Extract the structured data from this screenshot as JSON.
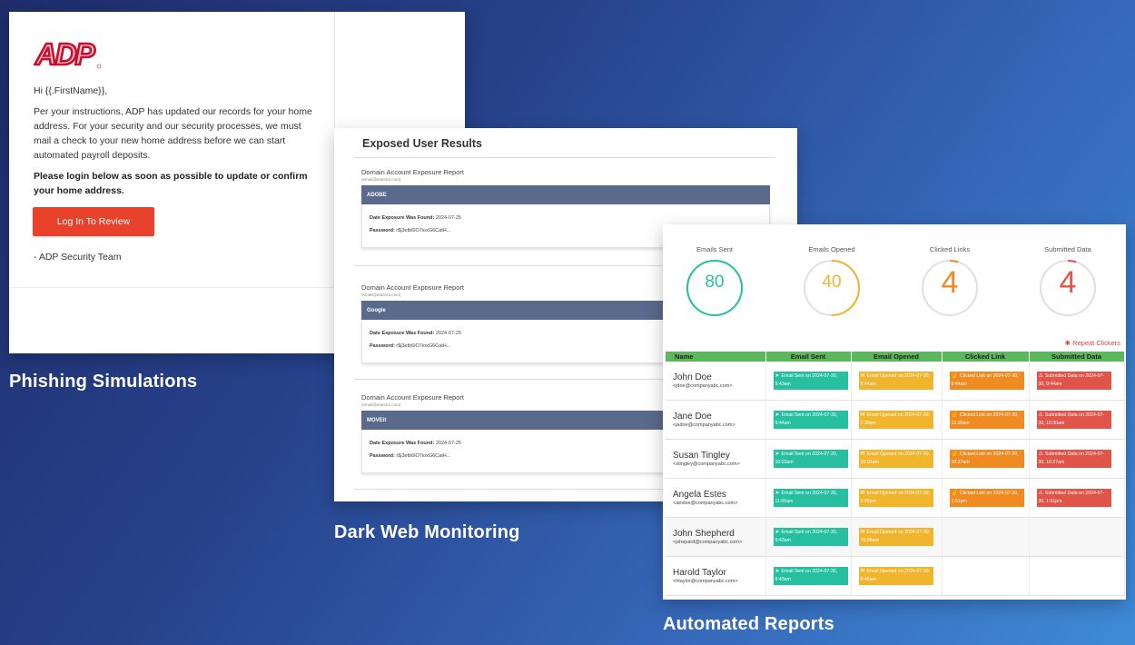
{
  "colors": {
    "brand_red": "#c8102e",
    "cta_red": "#e8412c",
    "sent_teal": "#26c0a0",
    "opened_yellow": "#f0b52c",
    "clicked_orange": "#f08b22",
    "submitted_red": "#e0544a",
    "table_header_green": "#5cb85c",
    "report_bar": "#5a6a8c"
  },
  "captions": {
    "phishing": "Phishing Simulations",
    "darkweb": "Dark Web Monitoring",
    "reports": "Automated Reports"
  },
  "email": {
    "logo_text": "ADP",
    "greeting": "Hi {{.FirstName}},",
    "body": "Per your instructions, ADP has updated our records for your home address. For your security and our security processes, we must mail a check to your new home address before we can start automated payroll deposits.",
    "emphasis": "Please login below as soon as possible to update or confirm your home address.",
    "cta_label": "Log In To Review",
    "signature": "- ADP Security Team"
  },
  "darkweb": {
    "title": "Exposed User Results",
    "entries": [
      {
        "report": "Domain Account Exposure Report",
        "sub": "(email@etactics.com)",
        "source": "ADOBE",
        "date_label": "Date Exposure Was Found:",
        "date": "2024-07-25",
        "password_label": "Password:",
        "password": "r$j3etb6lO7ioxG6CatH..."
      },
      {
        "report": "Domain Account Exposure Report",
        "sub": "(email@etactics.com)",
        "source": "Google",
        "date_label": "Date Exposure Was Found:",
        "date": "2024-07-25",
        "password_label": "Password:",
        "password": "r$j3etb6lO7ioxG6CatH..."
      },
      {
        "report": "Domain Account Exposure Report",
        "sub": "(email@etactics.com)",
        "source": "MOVEit",
        "date_label": "Date Exposure Was Found:",
        "date": "2024-07-25",
        "password_label": "Password:",
        "password": "r$j3etb6lO7ioxG6CatH..."
      }
    ]
  },
  "report": {
    "stats": [
      {
        "label": "Emails Sent",
        "value": "80",
        "fraction": 1.0,
        "color": "#26c0a0"
      },
      {
        "label": "Emails Opened",
        "value": "40",
        "fraction": 0.5,
        "color": "#f0b52c"
      },
      {
        "label": "Clicked Links",
        "value": "4",
        "fraction": 0.05,
        "color": "#f08b22"
      },
      {
        "label": "Submitted Data",
        "value": "4",
        "fraction": 0.05,
        "color": "#e0544a"
      }
    ],
    "repeat_clickers": "Repeat Clickers",
    "columns": [
      "Name",
      "Email Sent",
      "Email Opened",
      "Clicked Link",
      "Submitted Data"
    ],
    "rows": [
      {
        "name": "John Doe",
        "email": "<jdoe@companyabc.com>",
        "sent": "Email Sent on 2024-07-30, 9:43am",
        "opened": "Email Opened on 2024-07-30, 9:44am",
        "clicked": "Clicked Link on 2024-07-30, 9:44am",
        "submitted": "Submitted Data on 2024-07-30, 9:44am"
      },
      {
        "name": "Jane Doe",
        "email": "<jadoe@companyabc.com>",
        "sent": "Email Sent on 2024-07-30, 9:44am",
        "opened": "Email Opened on 2024-07-30, 2:30pm",
        "clicked": "Clicked Link on 2024-07-30, 10:30am",
        "submitted": "Submitted Data on 2024-07-30, 10:30am"
      },
      {
        "name": "Susan Tingley",
        "email": "<stingley@companyabc.com>",
        "sent": "Email Sent on 2024-07-30, 10:03am",
        "opened": "Email Opened on 2024-07-30, 10:03am",
        "clicked": "Clicked Link on 2024-07-30, 10:27am",
        "submitted": "Submitted Data on 2024-07-30, 10:27am"
      },
      {
        "name": "Angela Estes",
        "email": "<aestes@companyabc.com>",
        "sent": "Email Sent on 2024-07-30, 11:06am",
        "opened": "Email Opened on 2024-07-30, 1:05pm",
        "clicked": "Clicked Link on 2024-07-30, 1:51pm",
        "submitted": "Submitted Data on 2024-07-30, 1:51pm"
      },
      {
        "name": "John Shepherd",
        "email": "<jshepard@companyabc.com>",
        "sent": "Email Sent on 2024-07-30, 9:43am",
        "opened": "Email Opened on 2024-07-30, 10:06am",
        "clicked": "",
        "submitted": ""
      },
      {
        "name": "Harold Taylor",
        "email": "<htaylor@companyabc.com>",
        "sent": "Email Sent on 2024-07-30, 9:43am",
        "opened": "Email Opened on 2024-07-30, 9:46am",
        "clicked": "",
        "submitted": ""
      }
    ]
  }
}
